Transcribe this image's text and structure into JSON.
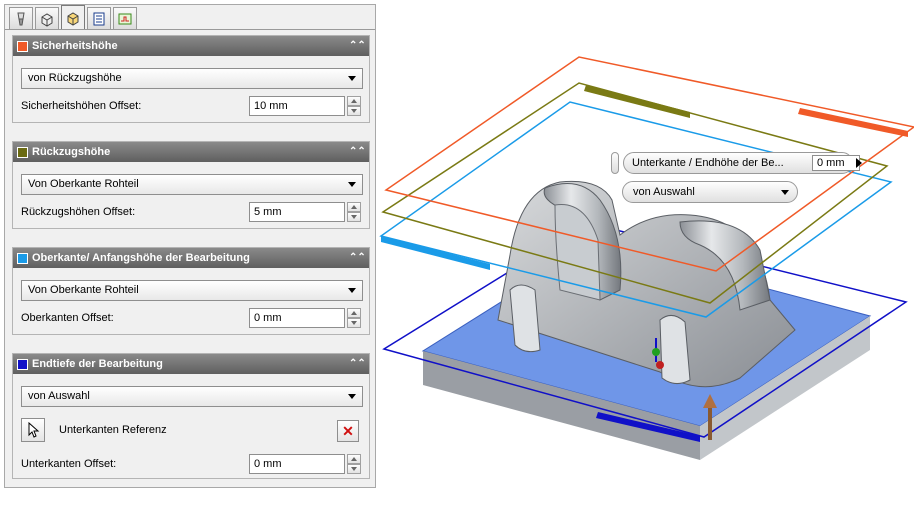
{
  "tabs": [
    {
      "icon": "tool-icon",
      "active": false
    },
    {
      "icon": "stock-box-icon",
      "active": false
    },
    {
      "icon": "heights-box-icon",
      "active": true
    },
    {
      "icon": "passes-icon",
      "active": false
    },
    {
      "icon": "linking-icon",
      "active": false
    }
  ],
  "groups": {
    "clearance": {
      "title": "Sicherheitshöhe",
      "color": "#f05a28",
      "select": "von Rückzugshöhe",
      "offset_label": "Sicherheitshöhen Offset:",
      "offset_value": "10 mm"
    },
    "retract": {
      "title": "Rückzugshöhe",
      "color": "#6b6b12",
      "select": "Von Oberkante Rohteil",
      "offset_label": "Rückzugshöhen Offset:",
      "offset_value": "5 mm"
    },
    "top": {
      "title": "Oberkante/ Anfangshöhe der Bearbeitung",
      "color": "#1a9be8",
      "select": "Von Oberkante Rohteil",
      "offset_label": "Oberkanten Offset:",
      "offset_value": "0 mm"
    },
    "bottom": {
      "title": "Endtiefe der Bearbeitung",
      "color": "#1010c8",
      "select": "von Auswahl",
      "reference_label": "Unterkanten Referenz",
      "offset_label": "Unterkanten Offset:",
      "offset_value": "0 mm"
    }
  },
  "viewport": {
    "minitoolbar": {
      "field_label": "Unterkante / Endhöhe der Be...",
      "field_value": "0 mm",
      "combo_value": "von Auswahl"
    }
  }
}
